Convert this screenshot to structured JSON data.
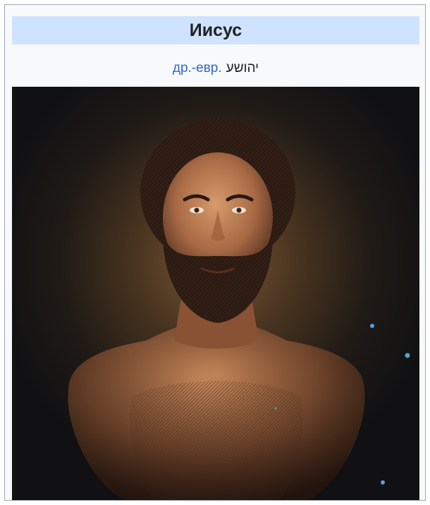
{
  "infobox": {
    "title": "Иисус",
    "subtitle": {
      "language_link": "др.-евр.",
      "native_name": "יהושע"
    },
    "image": {
      "alt_description": "portrait-reconstruction"
    }
  },
  "colors": {
    "title_background": "#cfe3ff",
    "infobox_background": "#f8f9fa",
    "border": "#a2a9b1",
    "link": "#3366cc",
    "text": "#202122",
    "dot_accent": "#4fa3d9"
  }
}
